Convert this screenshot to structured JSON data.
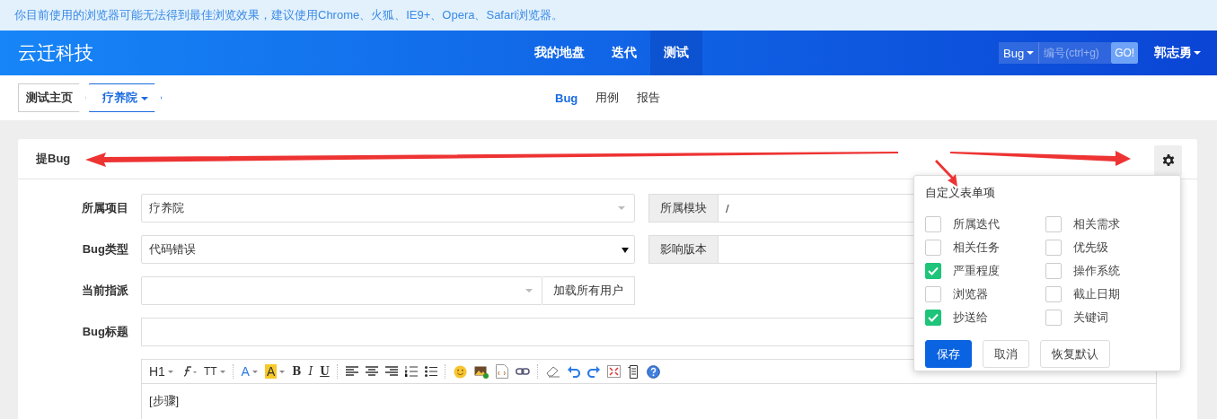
{
  "notice": "你目前使用的浏览器可能无法得到最佳浏览效果，建议使用Chrome、火狐、IE9+、Opera、Safari浏览器。",
  "header": {
    "logo": "云迁科技",
    "nav": [
      {
        "label": "我的地盘",
        "selected": false
      },
      {
        "label": "迭代",
        "selected": false
      },
      {
        "label": "测试",
        "selected": true
      }
    ],
    "search": {
      "type": "Bug",
      "placeholder": "编号(ctrl+g)",
      "button": "GO!"
    },
    "user": "郭志勇"
  },
  "breadcrumb": [
    {
      "label": "测试主页",
      "current": false
    },
    {
      "label": "疗养院",
      "current": true
    }
  ],
  "subtabs": [
    {
      "label": "Bug",
      "selected": true
    },
    {
      "label": "用例",
      "selected": false
    },
    {
      "label": "报告",
      "selected": false
    }
  ],
  "card": {
    "title": "提Bug",
    "rows": [
      {
        "label": "所属项目",
        "kind": "select",
        "value": "疗养院",
        "addon": "所属模块",
        "addon_value": "/"
      },
      {
        "label": "Bug类型",
        "kind": "native",
        "value": "代码错误",
        "addon": "影响版本"
      },
      {
        "label": "当前指派",
        "kind": "assign",
        "button": "加载所有用户"
      },
      {
        "label": "Bug标题",
        "kind": "input"
      }
    ],
    "toolbar": [
      {
        "kind": "text",
        "label": "H1"
      },
      {
        "kind": "font"
      },
      {
        "kind": "size",
        "label": "TT"
      },
      {
        "kind": "sep"
      },
      {
        "kind": "color",
        "label": "A"
      },
      {
        "kind": "highlight",
        "label": "A"
      },
      {
        "kind": "bold",
        "label": "B"
      },
      {
        "kind": "italic",
        "label": "I"
      },
      {
        "kind": "underline",
        "label": "U"
      },
      {
        "kind": "sep"
      },
      {
        "kind": "align-left"
      },
      {
        "kind": "align-center"
      },
      {
        "kind": "align-right"
      },
      {
        "kind": "ordered-list"
      },
      {
        "kind": "bullet-list"
      },
      {
        "kind": "sep"
      },
      {
        "kind": "emoji"
      },
      {
        "kind": "image"
      },
      {
        "kind": "code"
      },
      {
        "kind": "link"
      },
      {
        "kind": "sep"
      },
      {
        "kind": "eraser"
      },
      {
        "kind": "undo"
      },
      {
        "kind": "redo"
      },
      {
        "kind": "fullscreen"
      },
      {
        "kind": "template"
      },
      {
        "kind": "help"
      }
    ],
    "editor_text": "[步骤]"
  },
  "popup": {
    "title": "自定义表单项",
    "options": [
      {
        "label": "所属迭代",
        "checked": false
      },
      {
        "label": "相关需求",
        "checked": false
      },
      {
        "label": "相关任务",
        "checked": false
      },
      {
        "label": "优先级",
        "checked": false
      },
      {
        "label": "严重程度",
        "checked": true
      },
      {
        "label": "操作系统",
        "checked": false
      },
      {
        "label": "浏览器",
        "checked": false
      },
      {
        "label": "截止日期",
        "checked": false
      },
      {
        "label": "抄送给",
        "checked": true
      },
      {
        "label": "关键词",
        "checked": false
      }
    ],
    "buttons": [
      {
        "label": "保存",
        "kind": "primary"
      },
      {
        "label": "取消",
        "kind": "default"
      },
      {
        "label": "恢复默认",
        "kind": "default"
      }
    ]
  }
}
